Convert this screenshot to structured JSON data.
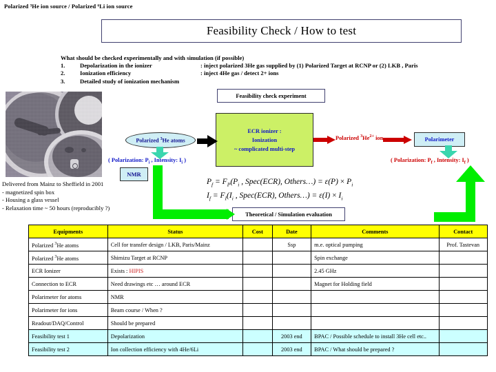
{
  "slide": {
    "subtitle": "Polarized ³He ion source / Polarized ⁶Li ion source",
    "title": "Feasibility Check / How to test"
  },
  "checklist": {
    "heading": "What should be checked experimentally and with simulation (if possible)",
    "rows": [
      {
        "num": "1.",
        "item": "Depolarization in the ionizer",
        "note": ": inject polarized 3He gas supplied by (1) Polarized Target  at RCNP  or (2) LKB , Paris"
      },
      {
        "num": "2.",
        "item": "Ionization efficiency",
        "note": ": inject 4He gas / detect 2+ ions"
      },
      {
        "num": "3.",
        "item": "Detailed study of ionization mechanism",
        "note": ""
      }
    ]
  },
  "photo_caption": [
    "Delivered from Mainz to Sheffield in 2001",
    "- magnetized spin box",
    "- Housing a glass vessel",
    "- Relaxation time ~ 50 hours (reproducibly ?)"
  ],
  "diagram": {
    "feasibility_box": "Feasibility check experiment",
    "atoms_oval": "Polarized ³He atoms",
    "ecr_box_line1": "ECR ionizer :",
    "ecr_box_line2": "Ionization",
    "ecr_box_line3": "~ complicated multi-step",
    "ion_label": "Polarized ³He²⁺ ion",
    "polarimeter_box": "Polarimeter",
    "nmr_box": "NMR",
    "polarization_left": "( Polarization: Pᵢ , Intensity:  Iᵢ )",
    "polarization_right": "( Polarization: Pf , Intensity:  If )",
    "theory_box": "Theoretical / Simulation evaluation",
    "formula_1": "Pf = Fₚ(Pᵢ , Spec(ECR), Others…) = ε(P) × Pᵢ",
    "formula_2": "If = Fᵢ(Iᵢ , Spec(ECR), Others…) = ε(I) × Iᵢ"
  },
  "colors": {
    "header_yellow": "#ffff00",
    "highlight_cyan": "#ccffff",
    "ecr_green": "#ccf066",
    "box_blue_fill": "#cfeef5",
    "red_arrow": "#cc0000",
    "green_arrow": "#00ee00",
    "teal_arrow": "#3ad6ae",
    "blue_text": "#1018c8"
  },
  "table": {
    "headers": [
      "Equipments",
      "Status",
      "Cost",
      "Date",
      "Comments",
      "Contact"
    ],
    "rows": [
      {
        "highlight": false,
        "cells": [
          "Polarized 3He atoms",
          "Cell for transfer design / LKB, Paris/Mainz",
          "",
          "Ssp",
          "m.e. optical pumping",
          "Prof. Tastevan"
        ]
      },
      {
        "highlight": false,
        "cells": [
          "Polarized 3He atoms",
          "Shimizu Target at RCNP",
          "",
          "",
          "Spin exchange",
          ""
        ]
      },
      {
        "highlight": false,
        "cells": [
          "ECR Ionizer",
          "Exists : HIPIS",
          "",
          "",
          "2.45 GHz",
          ""
        ],
        "status_red_part": "HIPIS"
      },
      {
        "highlight": false,
        "cells": [
          "Connection to ECR",
          "Need drawings etc … around ECR",
          "",
          "",
          "Magnet for Holding field",
          ""
        ]
      },
      {
        "highlight": false,
        "cells": [
          "Polarimeter for atoms",
          "NMR",
          "",
          "",
          "",
          ""
        ]
      },
      {
        "highlight": false,
        "cells": [
          "Polarimeter for ions",
          "Beam course / When ?",
          "",
          "",
          "",
          ""
        ]
      },
      {
        "highlight": false,
        "cells": [
          "Readout/DAQ/Control",
          "Should be prepared",
          "",
          "",
          "",
          ""
        ]
      },
      {
        "highlight": true,
        "cells": [
          "Feasibility test  1",
          "Depolarization",
          "",
          "2003 end",
          "BPAC / Possible schedule to install 3He cell etc..",
          ""
        ]
      },
      {
        "highlight": true,
        "cells": [
          "Feasibility test  2",
          "Ion collection efficiency with 4He/6Li",
          "",
          "2003 end",
          "BPAC / What should be prepared ?",
          ""
        ]
      }
    ]
  }
}
